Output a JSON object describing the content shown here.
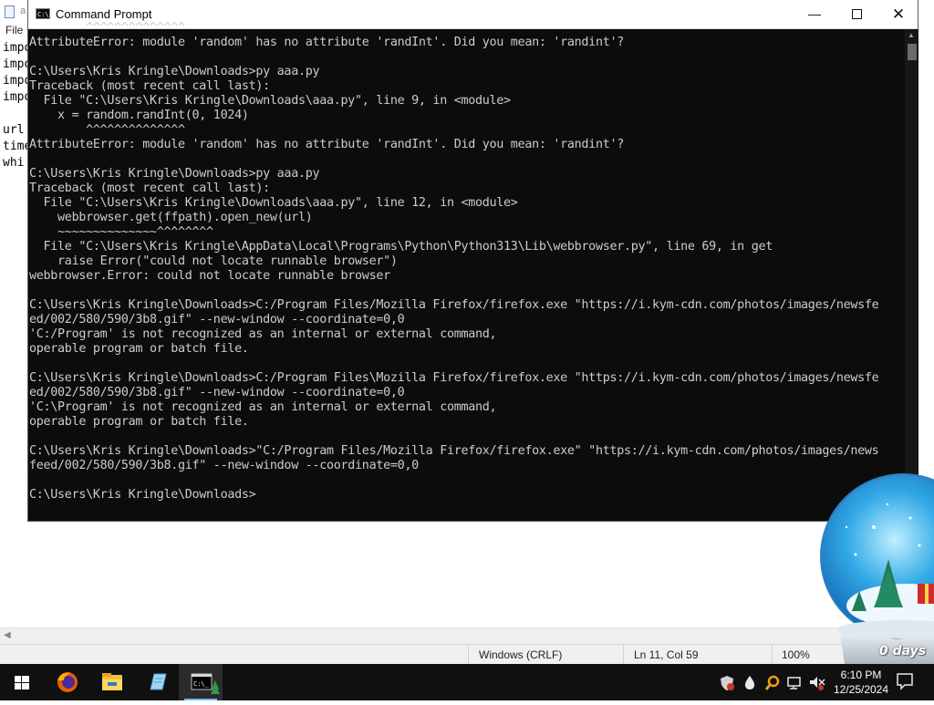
{
  "notepad": {
    "title_fragment": "a",
    "menu_fragment": "File",
    "lines": [
      "impo",
      "impo",
      "impo",
      "impo",
      "",
      "url",
      "time",
      "whi"
    ],
    "status": {
      "line_ending": "Windows (CRLF)",
      "position": "Ln 11, Col 59",
      "zoom": "100%"
    }
  },
  "cmd": {
    "title": "Command Prompt",
    "lines": [
      "        ^^^^^^^^^^^^^^",
      "AttributeError: module 'random' has no attribute 'randInt'. Did you mean: 'randint'?",
      "",
      "C:\\Users\\Kris Kringle\\Downloads>py aaa.py",
      "Traceback (most recent call last):",
      "  File \"C:\\Users\\Kris Kringle\\Downloads\\aaa.py\", line 9, in <module>",
      "    x = random.randInt(0, 1024)",
      "        ^^^^^^^^^^^^^^",
      "AttributeError: module 'random' has no attribute 'randInt'. Did you mean: 'randint'?",
      "",
      "C:\\Users\\Kris Kringle\\Downloads>py aaa.py",
      "Traceback (most recent call last):",
      "  File \"C:\\Users\\Kris Kringle\\Downloads\\aaa.py\", line 12, in <module>",
      "    webbrowser.get(ffpath).open_new(url)",
      "    ~~~~~~~~~~~~~~^^^^^^^^",
      "  File \"C:\\Users\\Kris Kringle\\AppData\\Local\\Programs\\Python\\Python313\\Lib\\webbrowser.py\", line 69, in get",
      "    raise Error(\"could not locate runnable browser\")",
      "webbrowser.Error: could not locate runnable browser",
      "",
      "C:\\Users\\Kris Kringle\\Downloads>C:/Program Files/Mozilla Firefox/firefox.exe \"https://i.kym-cdn.com/photos/images/newsfe",
      "ed/002/580/590/3b8.gif\" --new-window --coordinate=0,0",
      "'C:/Program' is not recognized as an internal or external command,",
      "operable program or batch file.",
      "",
      "C:\\Users\\Kris Kringle\\Downloads>C:/Program Files\\Mozilla Firefox/firefox.exe \"https://i.kym-cdn.com/photos/images/newsfe",
      "ed/002/580/590/3b8.gif\" --new-window --coordinate=0,0",
      "'C:\\Program' is not recognized as an internal or external command,",
      "operable program or batch file.",
      "",
      "C:\\Users\\Kris Kringle\\Downloads>\"C:/Program Files/Mozilla Firefox/firefox.exe\" \"https://i.kym-cdn.com/photos/images/news",
      "feed/002/580/590/3b8.gif\" --new-window --coordinate=0,0",
      "",
      "C:\\Users\\Kris Kringle\\Downloads>"
    ]
  },
  "globe": {
    "label": "0 days"
  },
  "taskbar": {
    "apps": [
      "start-icon",
      "firefox-icon",
      "file-explorer-icon",
      "notepad-icon",
      "command-prompt-icon"
    ],
    "clock_time": "6:10 PM",
    "clock_date": "12/25/2024"
  },
  "colors": {
    "console_bg": "#0c0c0c",
    "console_text": "#cccccc",
    "taskbar_bg": "#101010",
    "active_underline": "#76b9ed"
  }
}
